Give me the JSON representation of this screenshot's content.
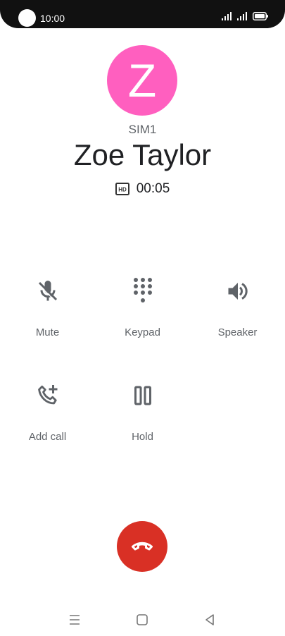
{
  "status_bar": {
    "time": "10:00",
    "icons": [
      "signal-icon",
      "signal-icon",
      "battery-icon"
    ]
  },
  "contact": {
    "initial": "Z",
    "avatar_color": "#ff5fbf",
    "sim": "SIM1",
    "name": "Zoe Taylor"
  },
  "call": {
    "quality_badge_icon": "hd-icon",
    "duration": "00:05"
  },
  "actions": [
    {
      "icon": "mute-icon",
      "label": "Mute"
    },
    {
      "icon": "keypad-icon",
      "label": "Keypad"
    },
    {
      "icon": "speaker-icon",
      "label": "Speaker"
    },
    {
      "icon": "add-call-icon",
      "label": "Add call"
    },
    {
      "icon": "hold-icon",
      "label": "Hold"
    }
  ],
  "end_call": {
    "icon": "end-call-icon",
    "color": "#d93025"
  },
  "navigation": {
    "icons": [
      "menu-icon",
      "home-icon",
      "back-icon"
    ]
  }
}
